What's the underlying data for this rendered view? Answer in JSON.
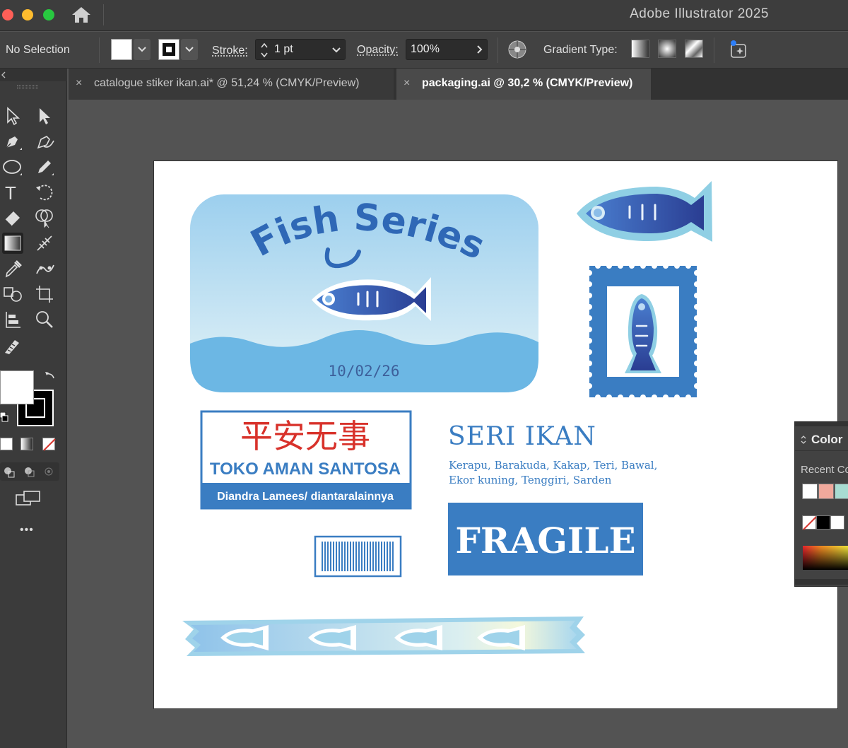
{
  "window": {
    "app_title": "Adobe Illustrator 2025"
  },
  "control_bar": {
    "selection_status": "No Selection",
    "stroke_label": "Stroke:",
    "stroke_value": "1 pt",
    "opacity_label": "Opacity:",
    "opacity_value": "100%",
    "gradient_type_label": "Gradient Type:"
  },
  "tabs": [
    {
      "label": "catalogue stiker ikan.ai* @ 51,24 % (CMYK/Preview)",
      "active": false,
      "close": "×"
    },
    {
      "label": "packaging.ai @ 30,2 % (CMYK/Preview)",
      "active": true,
      "close": "×"
    }
  ],
  "toolbar": {
    "more_label": "•••",
    "tools": [
      "selection-tool",
      "direct-selection-tool",
      "pen-tool",
      "curvature-tool",
      "ellipse-tool",
      "pencil-tool",
      "type-tool",
      "rotate-tool",
      "eraser-tool",
      "shape-builder-tool",
      "gradient-tool",
      "mesh-tool",
      "eyedropper-tool",
      "blend-tool",
      "symbol-sprayer-tool",
      "artboard-tool",
      "column-graph-tool",
      "zoom-tool",
      "shaper-tool"
    ]
  },
  "artboard": {
    "label_card": {
      "title": "Fish Series",
      "date": "10/02/26"
    },
    "store_label": {
      "chinese": "平安无事",
      "name": "TOKO AMAN SANTOSA",
      "footer": "Diandra Lamees/ diantaralainnya"
    },
    "seri_ikan": {
      "heading": "SERI IKAN",
      "line1": "Kerapu, Barakuda, Kakap, Teri, Bawal,",
      "line2": "Ekor kuning, Tenggiri, Sarden"
    },
    "fragile": "FRAGILE"
  },
  "color_panel": {
    "title": "Color",
    "recent_label": "Recent Co",
    "recent_swatches": [
      "#ffffff",
      "#f0a99c",
      "#a8dcd2"
    ]
  },
  "colors": {
    "brand_blue": "#3a7dc2",
    "dark_blue": "#2f55a4",
    "light_blue": "#9fd3ea",
    "red": "#d8322b"
  }
}
